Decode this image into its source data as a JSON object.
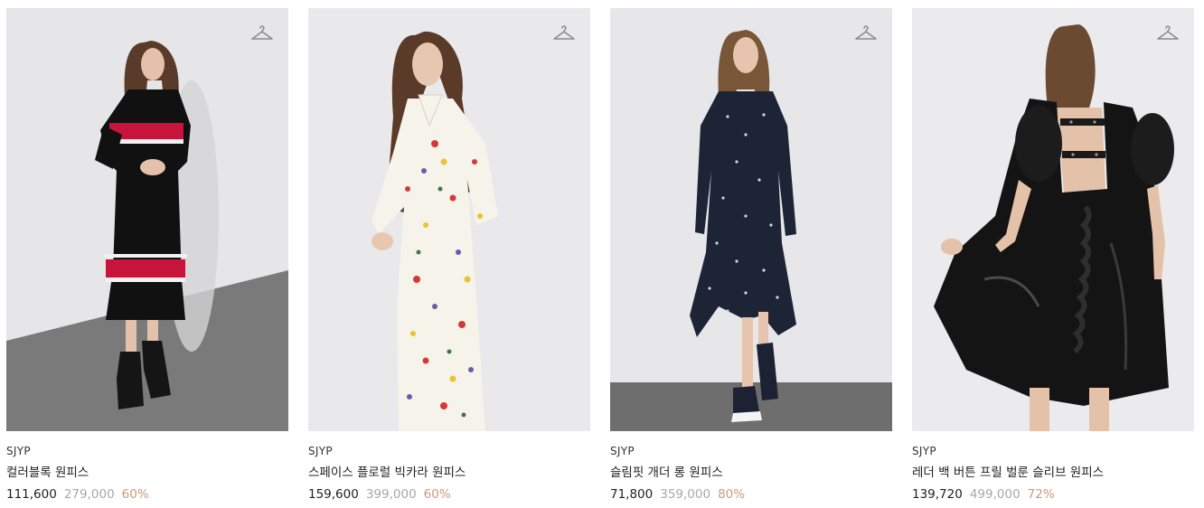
{
  "products": [
    {
      "brand": "SJYP",
      "name": "컬러블록 원피스",
      "price": "111,600",
      "original_price": "279,000",
      "discount": "60%"
    },
    {
      "brand": "SJYP",
      "name": "스페이스 플로럴 빅카라 원피스",
      "price": "159,600",
      "original_price": "399,000",
      "discount": "60%"
    },
    {
      "brand": "SJYP",
      "name": "슬림핏 개더 롱 원피스",
      "price": "71,800",
      "original_price": "359,000",
      "discount": "80%"
    },
    {
      "brand": "SJYP",
      "name": "레더 백 버튼 프릴 벌룬 슬리브 원피스",
      "price": "139,720",
      "original_price": "499,000",
      "discount": "72%"
    }
  ],
  "icons": {
    "wishlist": "hanger-icon"
  },
  "colors": {
    "discount": "#c99a7a",
    "original_price": "#a8a8a8",
    "text": "#222222"
  }
}
